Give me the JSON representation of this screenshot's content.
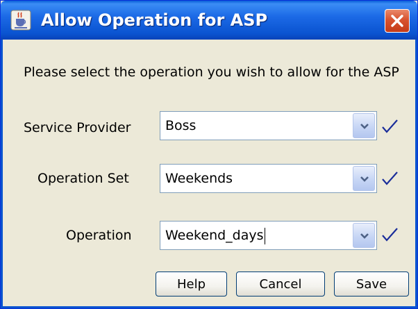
{
  "window": {
    "title": "Allow Operation for ASP",
    "icon": "java-cup-icon",
    "close_icon": "close-icon"
  },
  "instructions": "Please select the operation you wish to allow for the ASP",
  "fields": [
    {
      "label": "Service Provider",
      "value": "Boss",
      "valid_icon": "checkmark-icon"
    },
    {
      "label": "Operation Set",
      "value": "Weekends",
      "valid_icon": "checkmark-icon"
    },
    {
      "label": "Operation",
      "value": "Weekend_days",
      "valid_icon": "checkmark-icon"
    }
  ],
  "buttons": {
    "help": "Help",
    "cancel": "Cancel",
    "save": "Save"
  },
  "colors": {
    "titlebar": "#0a53d0",
    "close_button": "#d8532f",
    "dialog_bg": "#ece9d8",
    "checkmark": "#1a2d9a"
  }
}
